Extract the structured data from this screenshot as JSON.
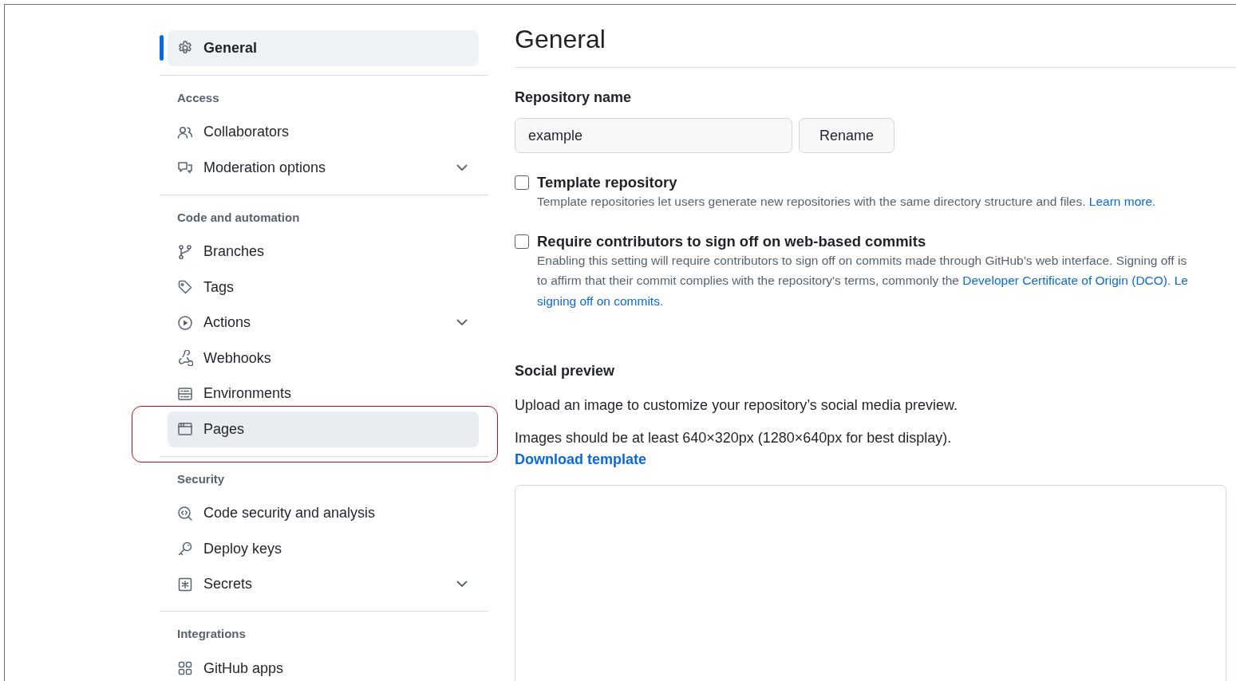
{
  "sidebar": {
    "groups": [
      {
        "items": [
          {
            "label": "General",
            "selected": true,
            "highlighted": false,
            "expandable": false
          }
        ]
      },
      {
        "heading": "Access",
        "items": [
          {
            "label": "Collaborators",
            "selected": false,
            "highlighted": false,
            "expandable": false
          },
          {
            "label": "Moderation options",
            "selected": false,
            "highlighted": false,
            "expandable": true
          }
        ]
      },
      {
        "heading": "Code and automation",
        "items": [
          {
            "label": "Branches",
            "selected": false,
            "highlighted": false,
            "expandable": false
          },
          {
            "label": "Tags",
            "selected": false,
            "highlighted": false,
            "expandable": false
          },
          {
            "label": "Actions",
            "selected": false,
            "highlighted": false,
            "expandable": true
          },
          {
            "label": "Webhooks",
            "selected": false,
            "highlighted": false,
            "expandable": false
          },
          {
            "label": "Environments",
            "selected": false,
            "highlighted": false,
            "expandable": false
          },
          {
            "label": "Pages",
            "selected": false,
            "highlighted": true,
            "expandable": false
          }
        ]
      },
      {
        "heading": "Security",
        "items": [
          {
            "label": "Code security and analysis",
            "selected": false,
            "highlighted": false,
            "expandable": false
          },
          {
            "label": "Deploy keys",
            "selected": false,
            "highlighted": false,
            "expandable": false
          },
          {
            "label": "Secrets",
            "selected": false,
            "highlighted": false,
            "expandable": true
          }
        ]
      },
      {
        "heading": "Integrations",
        "items": [
          {
            "label": "GitHub apps",
            "selected": false,
            "highlighted": false,
            "expandable": false
          }
        ]
      }
    ]
  },
  "main": {
    "title": "General",
    "repository_name": {
      "label": "Repository name",
      "value": "example",
      "button": "Rename"
    },
    "options": [
      {
        "title": "Template repository",
        "checked": false,
        "lines": [
          [
            {
              "text": "Template repositories let users generate new repositories with the same directory structure and files. "
            },
            {
              "text": "Learn more",
              "link": true
            },
            {
              "text": "."
            }
          ]
        ]
      },
      {
        "title": "Require contributors to sign off on web-based commits",
        "checked": false,
        "lines": [
          [
            {
              "text": "Enabling this setting will require contributors to sign off on commits made through GitHub’s web interface. Signing off is"
            }
          ],
          [
            {
              "text": "to affirm that their commit complies with the repository's terms, commonly the "
            },
            {
              "text": "Developer Certificate of Origin (DCO)",
              "link": true
            },
            {
              "text": ". "
            },
            {
              "text": "Le",
              "link": true
            }
          ],
          [
            {
              "text": "signing off on commits",
              "link": true
            },
            {
              "text": "."
            }
          ]
        ]
      }
    ],
    "social_preview": {
      "heading": "Social preview",
      "description": "Upload an image to customize your repository’s social media preview.",
      "requirements": "Images should be at least 640×320px (1280×640px for best display).",
      "link": "Download template"
    }
  }
}
